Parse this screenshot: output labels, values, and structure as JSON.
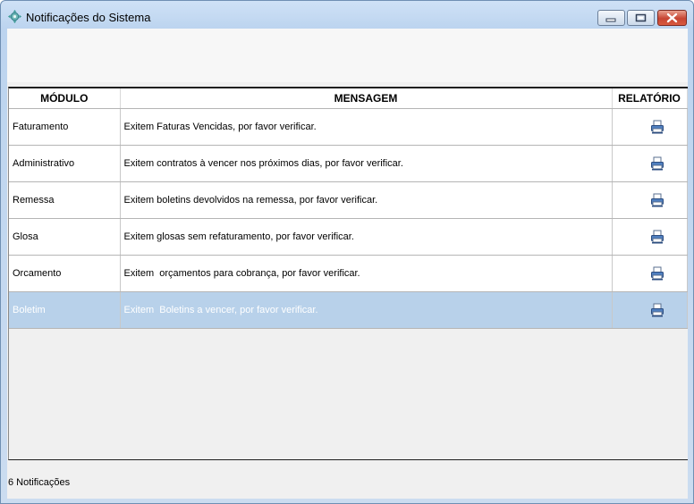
{
  "window": {
    "title": "Notificações do Sistema"
  },
  "icons": {
    "app": "app-icon",
    "minimize": "minimize-icon",
    "maximize": "maximize-icon",
    "close": "close-icon",
    "report": "printer-icon"
  },
  "colors": {
    "selected_row": "#b8d1ea",
    "close_button": "#c74533"
  },
  "table": {
    "columns": [
      "MÓDULO",
      "MENSAGEM",
      "RELATÓRIO"
    ],
    "rows": [
      {
        "module": "Faturamento",
        "message": "Exitem Faturas Vencidas, por favor verificar."
      },
      {
        "module": "Administrativo",
        "message": "Exitem contratos à vencer nos próximos dias, por favor verificar."
      },
      {
        "module": "Remessa",
        "message": "Exitem boletins devolvidos na remessa, por favor verificar."
      },
      {
        "module": "Glosa",
        "message": "Exitem glosas sem refaturamento, por favor verificar."
      },
      {
        "module": "Orcamento",
        "message": "Exitem  orçamentos para cobrança, por favor verificar."
      },
      {
        "module": "Boletim",
        "message": "Exitem  Boletins a vencer, por favor verificar.",
        "selected": true
      }
    ]
  },
  "status": {
    "count_text": "6 Notificações"
  }
}
